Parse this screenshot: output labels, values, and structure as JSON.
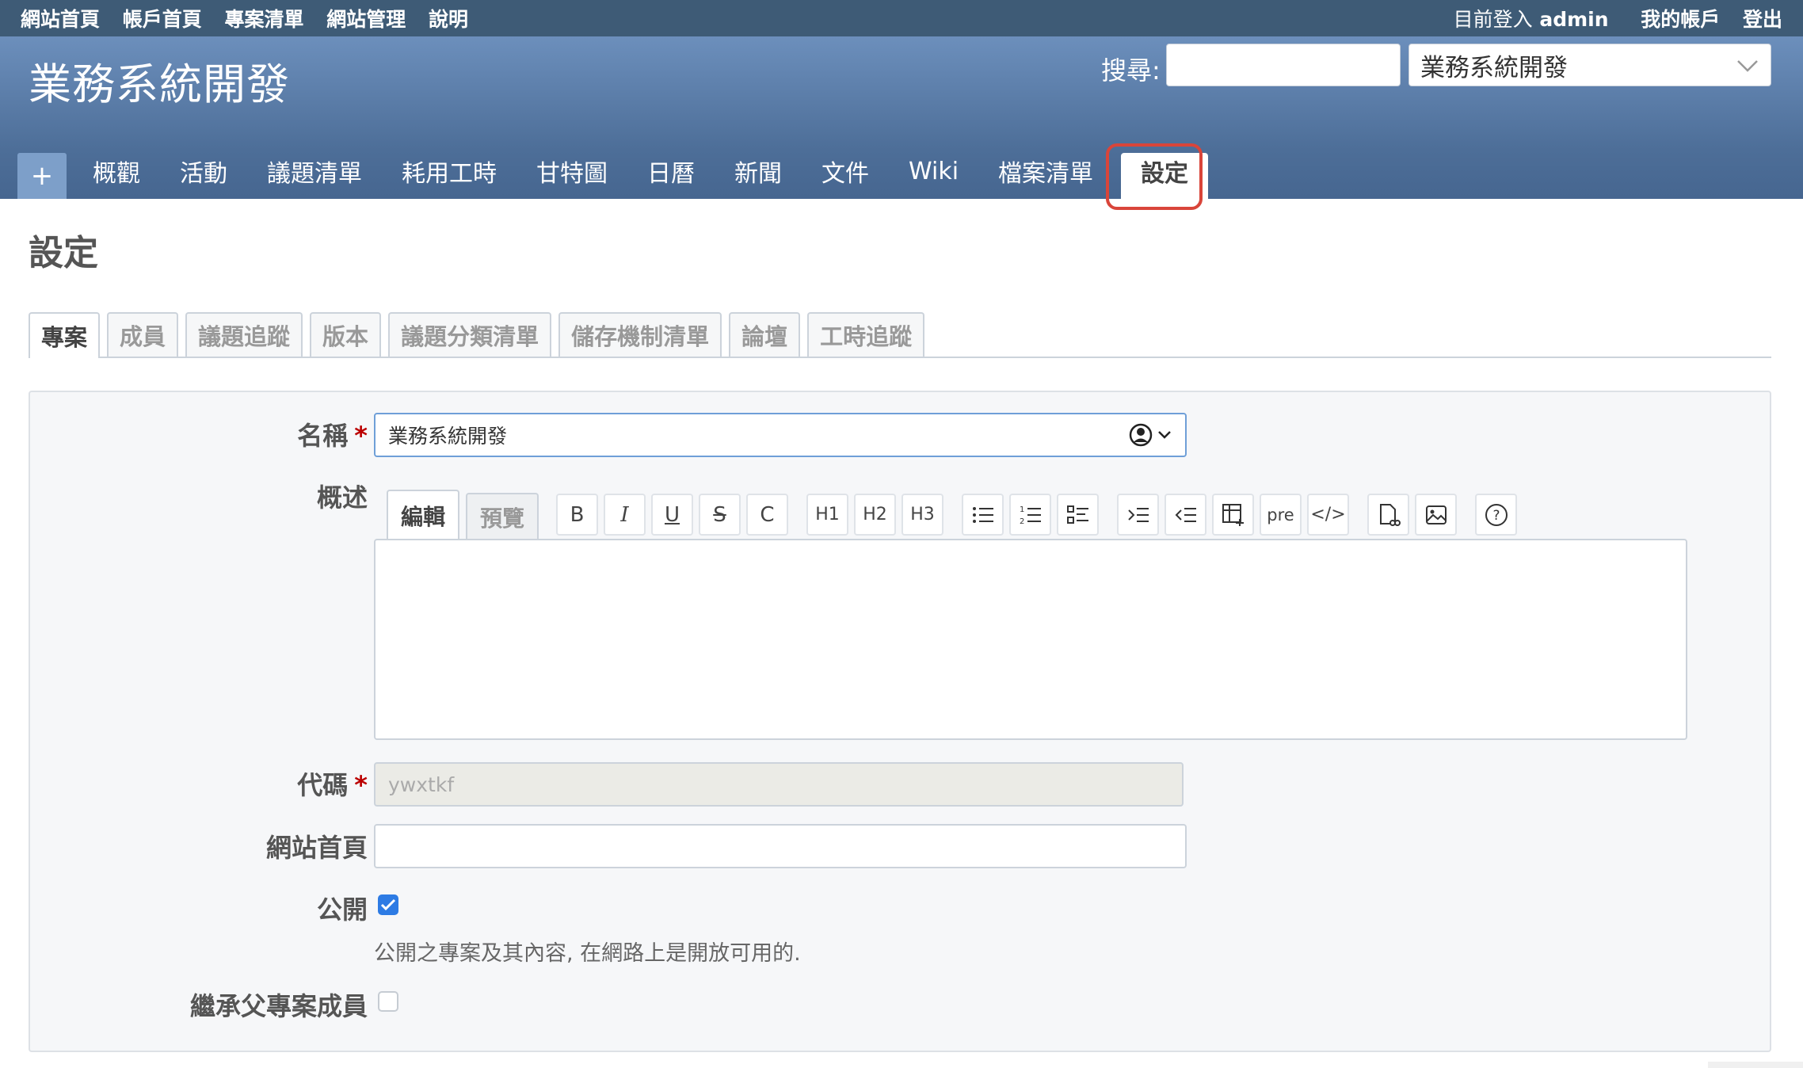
{
  "top_menu": {
    "left": [
      "網站首頁",
      "帳戶首頁",
      "專案清單",
      "網站管理",
      "說明"
    ],
    "logged_in_label": "目前登入",
    "user": "admin",
    "my_account": "我的帳戶",
    "logout": "登出"
  },
  "header": {
    "project_title": "業務系統開發",
    "search_label": "搜尋:",
    "search_value": "",
    "jump_value": "業務系統開發"
  },
  "main_menu": {
    "new_label": "+",
    "tabs": [
      "概觀",
      "活動",
      "議題清單",
      "耗用工時",
      "甘特圖",
      "日曆",
      "新聞",
      "文件",
      "Wiki",
      "檔案清單",
      "設定"
    ]
  },
  "content": {
    "title": "設定",
    "settings_tabs": [
      "專案",
      "成員",
      "議題追蹤",
      "版本",
      "議題分類清單",
      "儲存機制清單",
      "論壇",
      "工時追蹤"
    ]
  },
  "form": {
    "name_label": "名稱",
    "required_mark": "*",
    "name_value": "業務系統開發",
    "description_label": "概述",
    "editor_tabs": [
      "編輯",
      "預覽"
    ],
    "toolbar": {
      "bold": "B",
      "italic": "I",
      "underline": "U",
      "strike": "S",
      "code": "C",
      "h1": "H1",
      "h2": "H2",
      "h3": "H3",
      "pre": "pre",
      "inline_code": "</>",
      "help": "?"
    },
    "identifier_label": "代碼",
    "identifier_value": "ywxtkf",
    "homepage_label": "網站首頁",
    "homepage_value": "",
    "public_label": "公開",
    "public_checked": true,
    "public_hint": "公開之專案及其內容, 在網路上是開放可用的.",
    "inherit_label": "繼承父專案成員",
    "inherit_checked": false
  }
}
